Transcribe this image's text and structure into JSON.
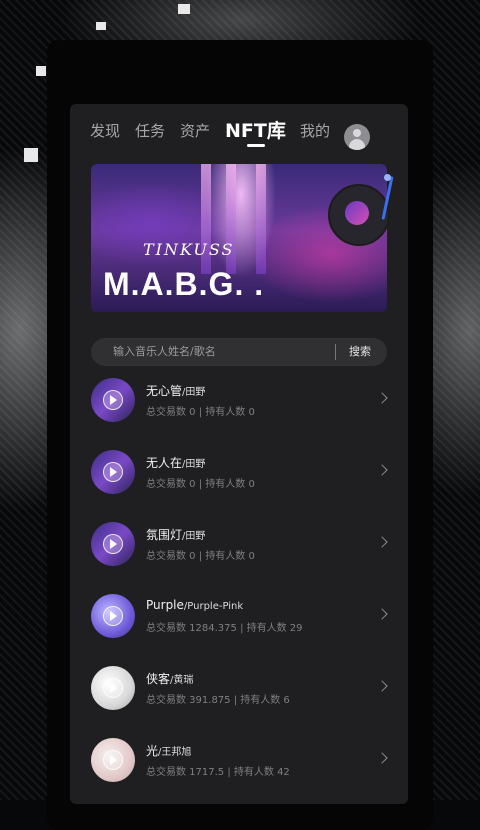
{
  "tabs": [
    {
      "label": "发现",
      "active": false
    },
    {
      "label": "任务",
      "active": false
    },
    {
      "label": "资产",
      "active": false
    },
    {
      "label": "NFT库",
      "active": true
    },
    {
      "label": "我的",
      "active": false
    }
  ],
  "banner": {
    "script_text": "TINKUSS",
    "title": "M.A.B.G. ."
  },
  "search": {
    "placeholder": "输入音乐人姓名/歌名",
    "button_label": "搜索"
  },
  "songs": [
    {
      "title": "无心管",
      "artist": "/田野",
      "stats": "总交易数 0 | 持有人数 0"
    },
    {
      "title": "无人在",
      "artist": "/田野",
      "stats": "总交易数 0 | 持有人数 0"
    },
    {
      "title": "氛围灯",
      "artist": "/田野",
      "stats": "总交易数 0 | 持有人数 0"
    },
    {
      "title": "Purple",
      "artist": "/Purple-Pink",
      "stats": "总交易数 1284.375 | 持有人数 29"
    },
    {
      "title": "侠客",
      "artist": "/黄瑞",
      "stats": "总交易数 391.875 | 持有人数 6"
    },
    {
      "title": "光",
      "artist": "/王邦旭",
      "stats": "总交易数 1717.5 | 持有人数 42"
    }
  ],
  "icons": {
    "avatar": "user-icon",
    "play": "play-icon",
    "chevron": "chevron-right-icon"
  }
}
